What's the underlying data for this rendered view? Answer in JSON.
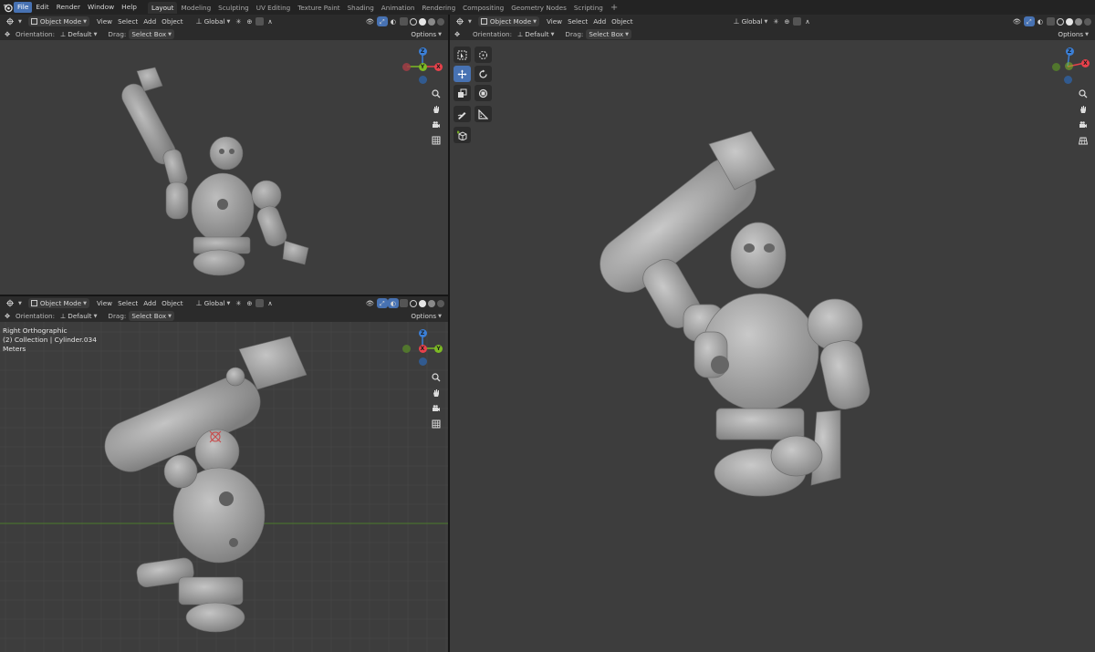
{
  "menubar": {
    "items": [
      "File",
      "Edit",
      "Render",
      "Window",
      "Help"
    ],
    "active_item": "File",
    "workspaces": [
      "Layout",
      "Modeling",
      "Sculpting",
      "UV Editing",
      "Texture Paint",
      "Shading",
      "Animation",
      "Rendering",
      "Compositing",
      "Geometry Nodes",
      "Scripting"
    ],
    "active_workspace": "Layout",
    "add_label": "+"
  },
  "viewport_header": {
    "mode": "Object Mode",
    "menus": [
      "View",
      "Select",
      "Add",
      "Object"
    ],
    "transform_orientation": "Global"
  },
  "tool_header": {
    "orientation_label": "Orientation:",
    "orientation_value": "Default",
    "drag_label": "Drag:",
    "drag_value": "Select Box",
    "options": "Options"
  },
  "viewports": {
    "top_left": {
      "view": "perspective"
    },
    "bottom_left": {
      "view_name": "Right Orthographic",
      "collection": "(2) Collection | Cylinder.034",
      "units": "Meters"
    },
    "right": {
      "view": "perspective"
    }
  },
  "gizmo_axes": {
    "x": "X",
    "y": "Y",
    "z": "Z"
  },
  "colors": {
    "accent": "#4772b3",
    "viewport_bg": "#3d3d3d",
    "x_axis": "#e8414b",
    "y_axis": "#7dba24",
    "z_axis": "#3b7fd6",
    "grid_line": "#474747",
    "x_axis_line": "#6f3434",
    "y_axis_line": "#4c7a2a"
  },
  "icons": {
    "nav": [
      "zoom-icon",
      "hand-pan-icon",
      "camera-icon",
      "grid-ortho-icon"
    ],
    "tools": [
      "select-box-icon",
      "cursor-icon",
      "move-icon",
      "rotate-icon",
      "scale-icon",
      "transform-icon",
      "annotate-icon",
      "measure-icon",
      "add-cube-icon"
    ]
  }
}
